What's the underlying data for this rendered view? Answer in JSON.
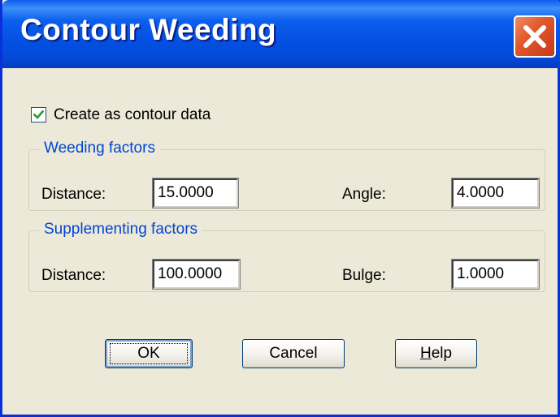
{
  "window": {
    "title": "Contour Weeding"
  },
  "checkbox": {
    "label": "Create as contour data",
    "checked": true
  },
  "weeding": {
    "legend": "Weeding factors",
    "distance_label": "Distance:",
    "distance_value": "15.0000",
    "angle_label": "Angle:",
    "angle_value": "4.0000"
  },
  "supplementing": {
    "legend": "Supplementing factors",
    "distance_label": "Distance:",
    "distance_value": "100.0000",
    "bulge_label": "Bulge:",
    "bulge_value": "1.0000"
  },
  "buttons": {
    "ok": "OK",
    "cancel": "Cancel",
    "help_prefix": "H",
    "help_rest": "elp"
  },
  "icons": {
    "close": "close-icon",
    "check": "checkmark-icon"
  },
  "colors": {
    "titlebar": "#0450E2",
    "dialog_bg": "#ECE9D8",
    "group_legend": "#0046D5",
    "close_button": "#E15A2C",
    "checkmark": "#21A121"
  }
}
